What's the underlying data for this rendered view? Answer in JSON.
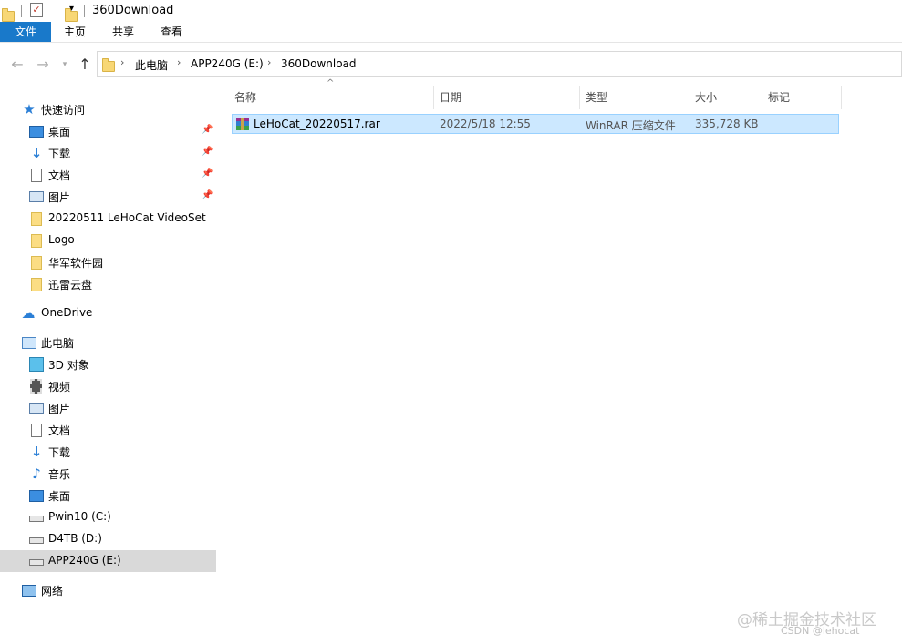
{
  "window": {
    "title": "360Download"
  },
  "ribbon": {
    "tabs": [
      "文件",
      "主页",
      "共享",
      "查看"
    ]
  },
  "address": {
    "crumbs": [
      "此电脑",
      "APP240G (E:)",
      "360Download"
    ]
  },
  "sidebar": {
    "quick_access": "快速访问",
    "quick_items": [
      "桌面",
      "下载",
      "文档",
      "图片",
      "20220511 LeHoCat VideoSet",
      "Logo",
      "华军软件园",
      "迅雷云盘"
    ],
    "onedrive": "OneDrive",
    "this_pc": "此电脑",
    "pc_items": [
      "3D 对象",
      "视频",
      "图片",
      "文档",
      "下载",
      "音乐",
      "桌面",
      "Pwin10 (C:)",
      "D4TB (D:)",
      "APP240G (E:)"
    ],
    "network": "网络"
  },
  "columns": [
    "名称",
    "日期",
    "类型",
    "大小",
    "标记"
  ],
  "files": [
    {
      "name": "LeHoCat_20220517.rar",
      "date": "2022/5/18 12:55",
      "type": "WinRAR 压缩文件",
      "size": "335,728 KB"
    }
  ],
  "watermark": {
    "main": "@稀土掘金技术社区",
    "sub": "CSDN @lehocat"
  },
  "colors": {
    "accent": "#1979ca",
    "selected_row": "#cce8ff",
    "sidebar_selected": "#d9d9d9"
  }
}
